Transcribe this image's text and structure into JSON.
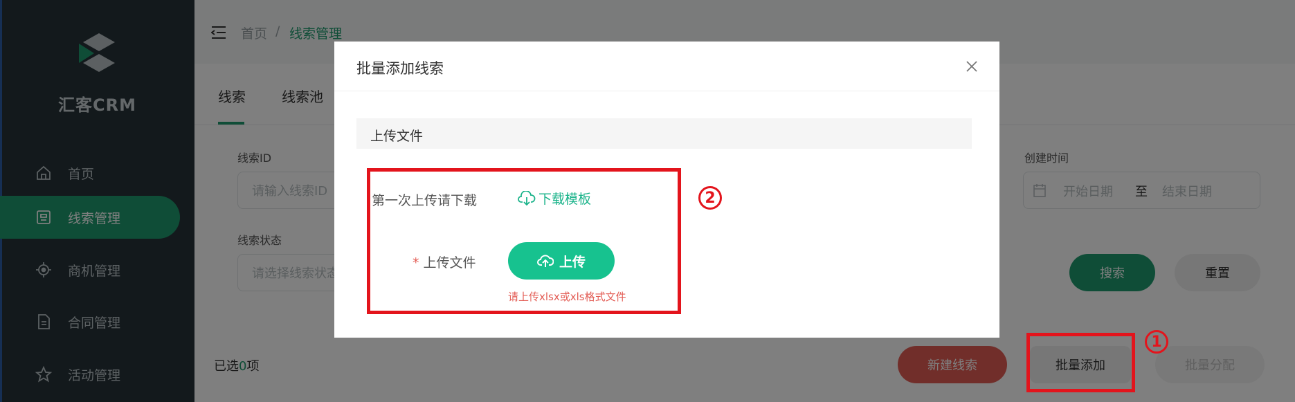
{
  "brand": {
    "name": "汇客CRM"
  },
  "sidebar": {
    "items": [
      {
        "label": "首页",
        "icon": "home-icon"
      },
      {
        "label": "线索管理",
        "icon": "clue-icon",
        "active": true
      },
      {
        "label": "商机管理",
        "icon": "target-icon"
      },
      {
        "label": "合同管理",
        "icon": "document-icon"
      },
      {
        "label": "活动管理",
        "icon": "star-icon"
      }
    ]
  },
  "breadcrumb": {
    "home": "首页",
    "separator": "/",
    "current": "线索管理"
  },
  "tabs": [
    {
      "label": "线索"
    },
    {
      "label": "线索池"
    }
  ],
  "filters": {
    "clue_id": {
      "label": "线索ID",
      "placeholder": "请输入线索ID"
    },
    "clue_status": {
      "label": "线索状态",
      "placeholder": "请选择线索状态"
    },
    "created_time": {
      "label": "创建时间",
      "start_placeholder": "开始日期",
      "to": "至",
      "end_placeholder": "结束日期"
    }
  },
  "actions": {
    "search": "搜索",
    "reset": "重置",
    "new_clue": "新建线索",
    "batch_add": "批量添加",
    "batch_assign": "批量分配"
  },
  "selection": {
    "prefix": "已选",
    "count": "0",
    "suffix": "项"
  },
  "dialog": {
    "title": "批量添加线索",
    "section": "上传文件",
    "first_upload_label": "第一次上传请下载",
    "download_template": "下载模板",
    "required_mark": "*",
    "upload_label": "上传文件",
    "upload_button": "上传",
    "hint": "请上传xlsx或xls格式文件"
  },
  "annotations": {
    "marker1": "1",
    "marker2": "2"
  },
  "colors": {
    "primary": "#1e9b6e",
    "upload_green": "#17c28f",
    "danger": "#e35d55",
    "annotation_red": "#e3141c",
    "sidebar_bg": "#263238"
  }
}
